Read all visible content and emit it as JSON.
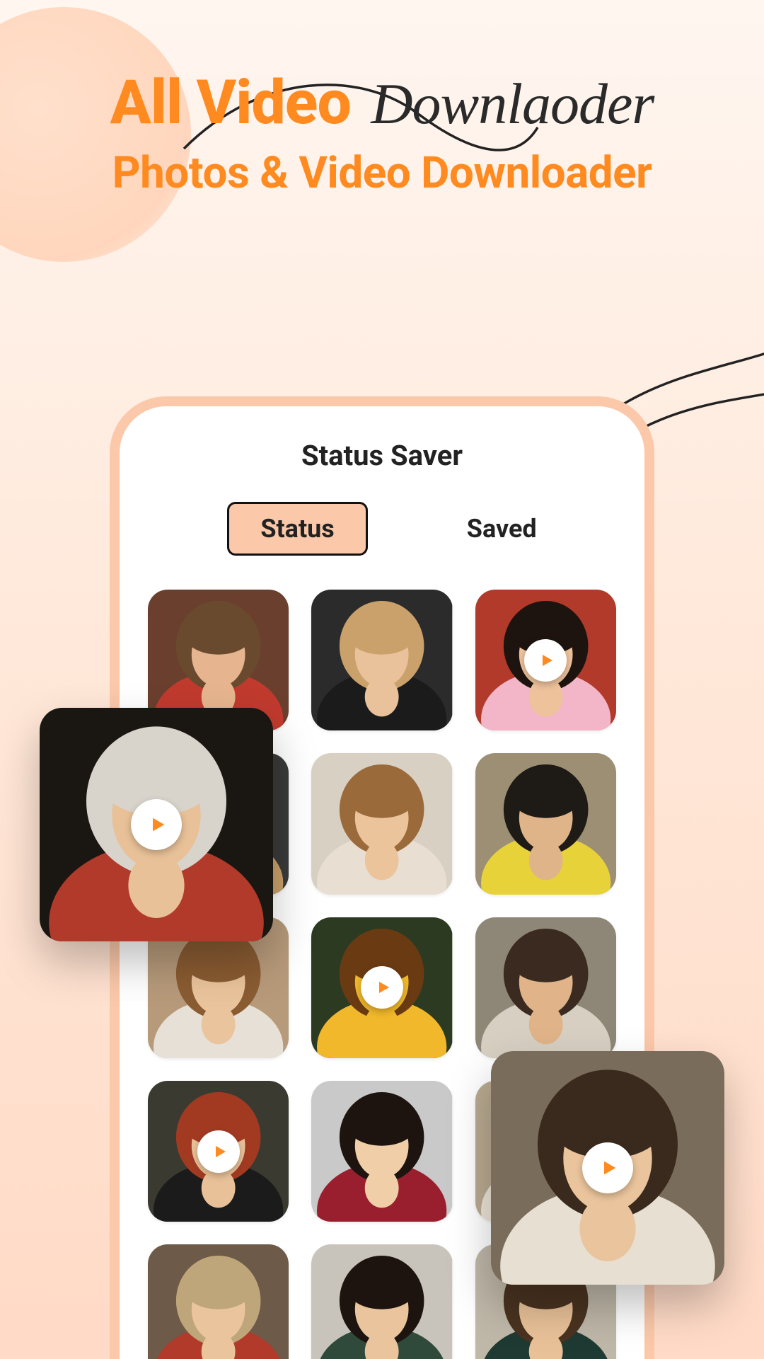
{
  "colors": {
    "accent": "#ff8a1f",
    "frame": "#fbc8a9",
    "ink": "#222222"
  },
  "headline": {
    "brand": "All Video",
    "script": "Downlaoder",
    "subtitle": "Photos & Video Downloader"
  },
  "phone": {
    "title": "Status Saver",
    "tabs": {
      "status": "Status",
      "saved": "Saved",
      "active": "status"
    }
  },
  "icons": {
    "play": "play-icon"
  },
  "thumbs": [
    {
      "name": "thumb-1",
      "video": false,
      "fill": {
        "bg": "#6b3f2e",
        "face": "#e6b58f",
        "hair": "#6a4a2e",
        "accent": "#c13a2e"
      }
    },
    {
      "name": "thumb-2",
      "video": false,
      "fill": {
        "bg": "#2b2b2b",
        "face": "#e9c19a",
        "hair": "#caa16a",
        "accent": "#1b1b1b"
      }
    },
    {
      "name": "thumb-3",
      "video": true,
      "fill": {
        "bg": "#b23a2a",
        "face": "#eec29b",
        "hair": "#1d1410",
        "accent": "#f2b6c8"
      }
    },
    {
      "name": "thumb-4",
      "video": false,
      "fill": {
        "bg": "#3a3a3a",
        "face": "#e4b78e",
        "hair": "#5d3c22",
        "accent": "#caa16a"
      }
    },
    {
      "name": "thumb-5",
      "video": false,
      "fill": {
        "bg": "#d9d0c4",
        "face": "#ecc49c",
        "hair": "#9a6a3a",
        "accent": "#e8dfd2"
      }
    },
    {
      "name": "thumb-6",
      "video": false,
      "fill": {
        "bg": "#9c8f73",
        "face": "#dfb489",
        "hair": "#1e1a16",
        "accent": "#e8d23a"
      }
    },
    {
      "name": "thumb-7",
      "video": false,
      "fill": {
        "bg": "#b79a7a",
        "face": "#eac49c",
        "hair": "#8a5c32",
        "accent": "#e6e0d6"
      }
    },
    {
      "name": "thumb-8",
      "video": true,
      "fill": {
        "bg": "#2c3a22",
        "face": "#f0b82a",
        "hair": "#6a3b12",
        "accent": "#f0b82a"
      }
    },
    {
      "name": "thumb-9",
      "video": false,
      "fill": {
        "bg": "#8e8676",
        "face": "#e0b388",
        "hair": "#3a2a20",
        "accent": "#d7cfc2"
      }
    },
    {
      "name": "thumb-10",
      "video": true,
      "fill": {
        "bg": "#3a3a30",
        "face": "#e8c198",
        "hair": "#a23a22",
        "accent": "#1b1b1b"
      }
    },
    {
      "name": "thumb-11",
      "video": false,
      "fill": {
        "bg": "#c9c9c9",
        "face": "#f0cfa8",
        "hair": "#1d1410",
        "accent": "#9a1f2e"
      }
    },
    {
      "name": "thumb-12",
      "video": false,
      "fill": {
        "bg": "#b9aa91",
        "face": "#e9c39a",
        "hair": "#3e2b1c",
        "accent": "#ece4d6"
      }
    },
    {
      "name": "thumb-13",
      "video": false,
      "fill": {
        "bg": "#6d5a48",
        "face": "#eac49c",
        "hair": "#bfa67a",
        "accent": "#b23a2a"
      }
    },
    {
      "name": "thumb-14",
      "video": false,
      "fill": {
        "bg": "#c9c4bb",
        "face": "#eac49c",
        "hair": "#1d1410",
        "accent": "#2f4a3a"
      }
    },
    {
      "name": "thumb-15",
      "video": false,
      "fill": {
        "bg": "#bfb7a8",
        "face": "#e8c198",
        "hair": "#4a3320",
        "accent": "#1f3a32"
      }
    }
  ],
  "floaters": {
    "left": {
      "name": "float-left",
      "fill": {
        "bg": "#1a1612",
        "face": "#e8c198",
        "hair": "#d8d4cc",
        "accent": "#b23a2a"
      }
    },
    "right": {
      "name": "float-right",
      "fill": {
        "bg": "#7a6c5a",
        "face": "#eac49c",
        "hair": "#3a2a1e",
        "accent": "#e6dfd2"
      }
    }
  }
}
